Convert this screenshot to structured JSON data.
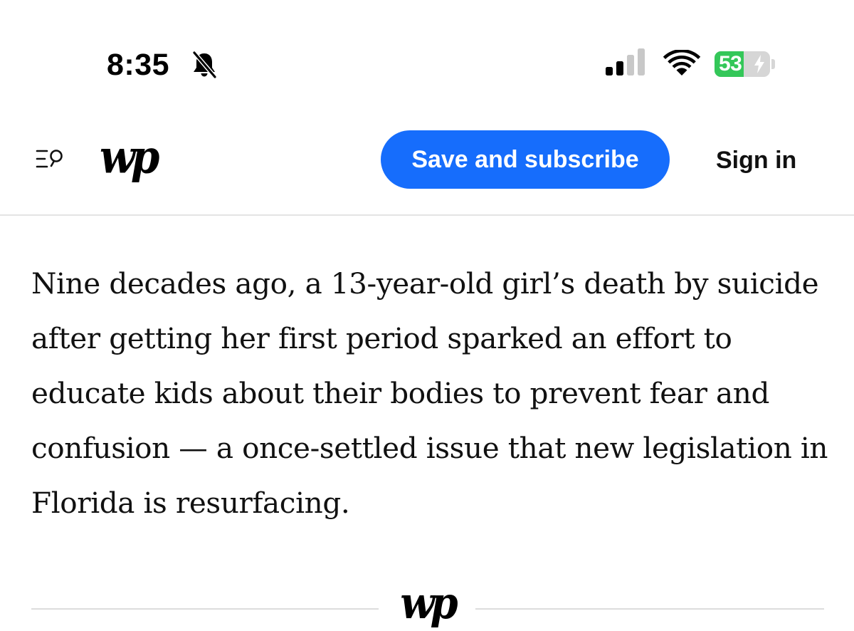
{
  "status_bar": {
    "time": "8:35",
    "battery_level": 53,
    "battery_text": "53",
    "battery_color": "#34c759",
    "icons": [
      "bell-slash-icon",
      "cellular-signal-icon",
      "wifi-icon",
      "battery-icon",
      "charging-bolt-icon"
    ],
    "signal_bars_active": 2,
    "signal_bars_total": 4
  },
  "header": {
    "logo_text": "wp",
    "subscribe_label": "Save and subscribe",
    "signin_label": "Sign in",
    "accent_color": "#166dfc",
    "icons": [
      "menu-search-icon"
    ]
  },
  "article": {
    "body": "Nine decades ago, a 13-year-old girl’s death by suicide after getting her first period sparked an effort to educate kids about their bodies to prevent fear and confusion — a once-settled issue that new legislation in Florida is resurfacing."
  },
  "divider": {
    "logo_text": "wp"
  }
}
